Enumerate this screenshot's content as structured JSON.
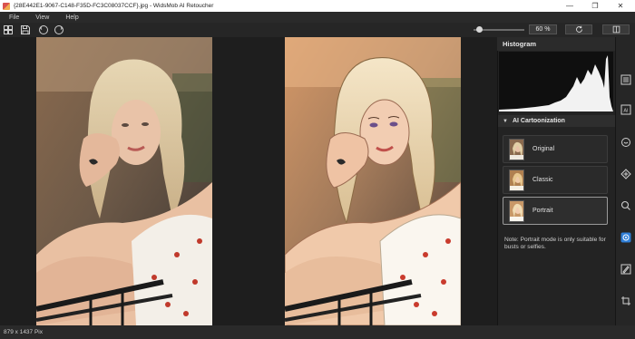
{
  "window": {
    "title": "{28E442E1-9067-C148-F35D-FC3C08037CCF}.jpg - WidsMob AI Retoucher",
    "controls": {
      "minimize": "—",
      "maximize": "❐",
      "close": "✕"
    }
  },
  "menu": {
    "file": "File",
    "view": "View",
    "help": "Help"
  },
  "toolbar": {
    "zoom_value": "60 %",
    "zoom_level": 0.1
  },
  "panel": {
    "histogram_title": "Histogram",
    "section_title": "AI Cartoonization",
    "modes": [
      {
        "label": "Original",
        "selected": false
      },
      {
        "label": "Classic",
        "selected": false
      },
      {
        "label": "Portrait",
        "selected": true
      }
    ],
    "note": "Note: Portrait mode is only suitable for busts or selfies."
  },
  "status": {
    "dimensions": "879 x 1437 Pix"
  },
  "colors": {
    "accent": "#2f7fd8",
    "panel_bg": "#232323",
    "canvas_bg": "#1e1e1e"
  }
}
